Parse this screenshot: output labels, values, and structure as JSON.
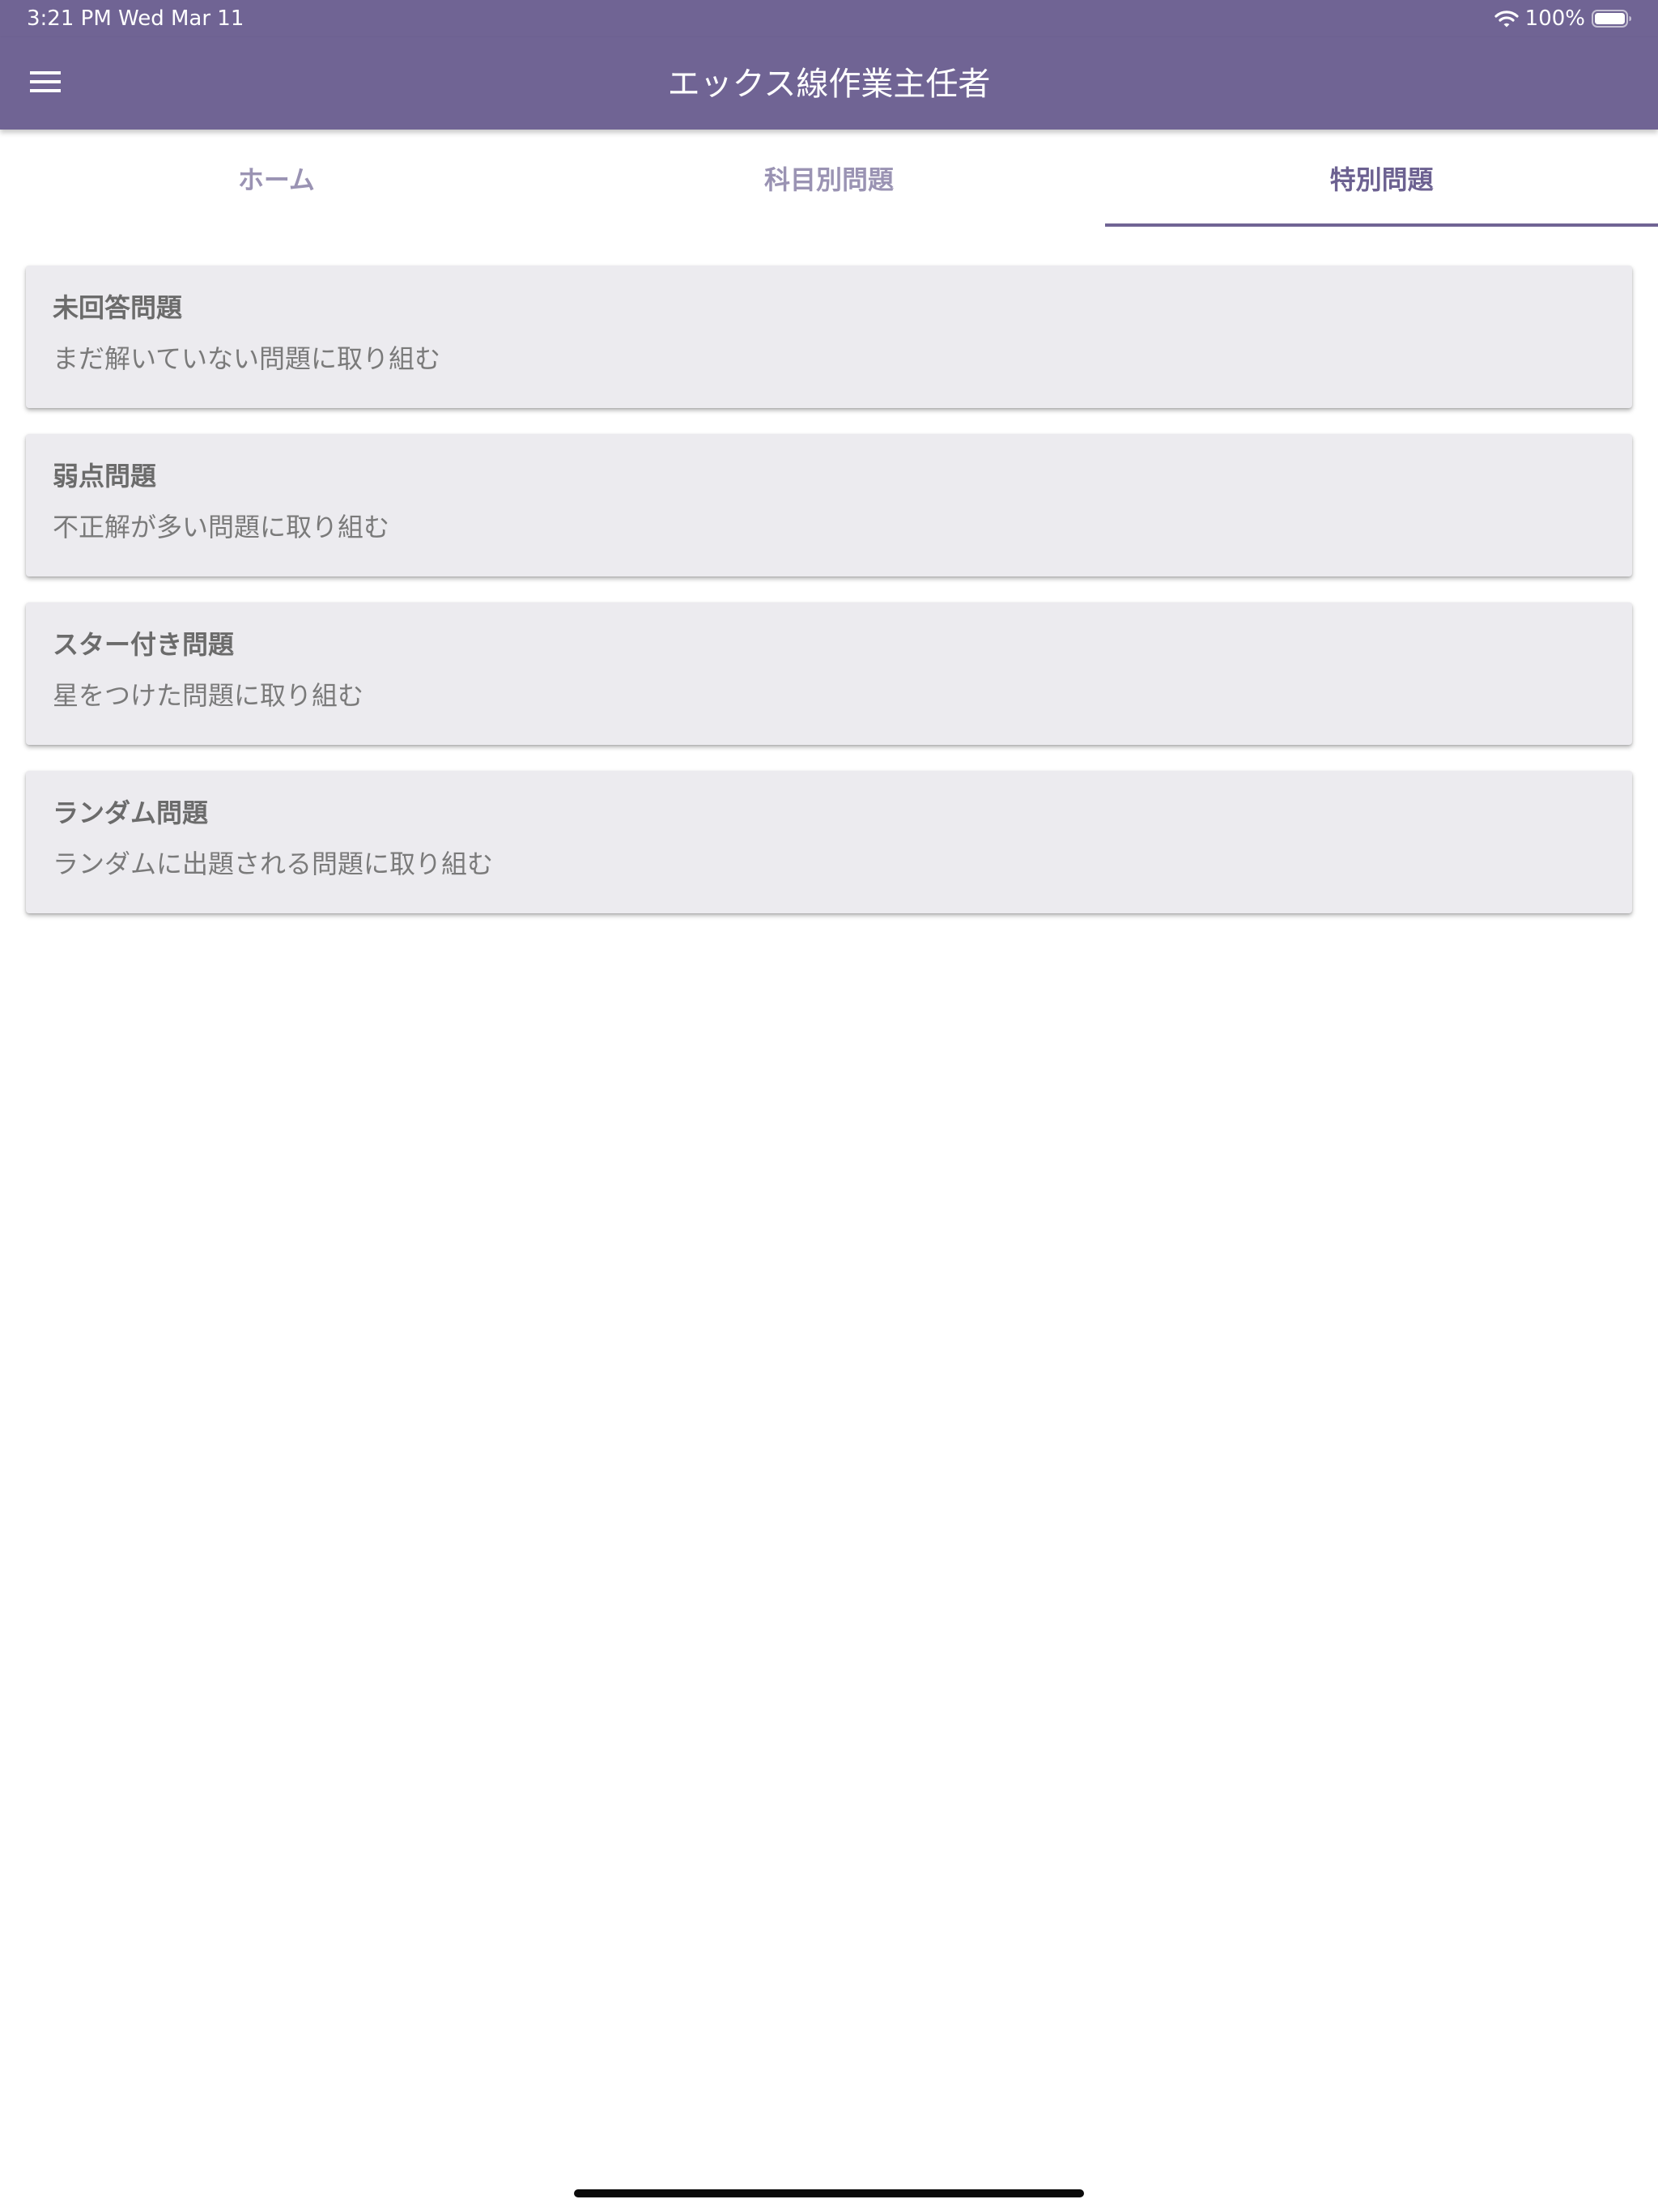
{
  "status_bar": {
    "time_date": "3:21 PM   Wed Mar 11",
    "battery": "100%",
    "wifi_icon": "wifi-icon",
    "battery_icon": "battery-icon"
  },
  "app_bar": {
    "title": "エックス線作業主任者",
    "menu_icon": "hamburger-menu-icon",
    "color": "#706494"
  },
  "tabs": [
    {
      "label": "ホーム",
      "active": false
    },
    {
      "label": "科目別問題",
      "active": false
    },
    {
      "label": "特別問題",
      "active": true
    }
  ],
  "cards": [
    {
      "title": "未回答問題",
      "subtitle": "まだ解いていない問題に取り組む"
    },
    {
      "title": "弱点問題",
      "subtitle": "不正解が多い問題に取り組む"
    },
    {
      "title": "スター付き問題",
      "subtitle": "星をつけた問題に取り組む"
    },
    {
      "title": "ランダム問題",
      "subtitle": "ランダムに出題される問題に取り組む"
    }
  ]
}
